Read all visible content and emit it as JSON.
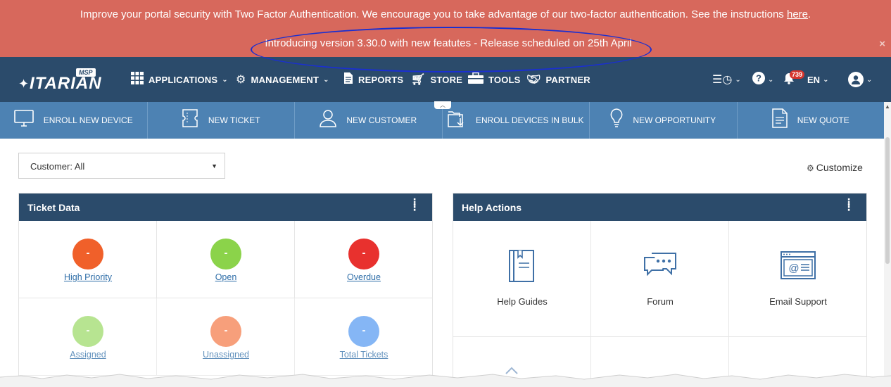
{
  "banner": {
    "line1_text": "Improve your portal security with Two Factor Authentication. We encourage you to take advantage of our two-factor authentication. See the instructions ",
    "line1_link": "here",
    "line1_end": ".",
    "line2_text": "Introducing version 3.30.0 with new featutes - Release scheduled on 25th April",
    "close_glyph": "×",
    "background": "#d7685c"
  },
  "logo": {
    "badge": "MSP",
    "word": "ITARIAN"
  },
  "nav": {
    "items": [
      {
        "label": "APPLICATIONS",
        "icon": "grid-icon"
      },
      {
        "label": "MANAGEMENT",
        "icon": "gears-icon"
      },
      {
        "label": "REPORTS",
        "icon": "document-icon"
      },
      {
        "label": "STORE",
        "icon": "cart-icon"
      },
      {
        "label": "TOOLS",
        "icon": "toolbox-icon"
      },
      {
        "label": "PARTNER",
        "icon": "handshake-icon"
      }
    ],
    "notification_count": "739",
    "language": "EN"
  },
  "quick_actions": [
    {
      "label": "ENROLL NEW DEVICE",
      "icon": "monitor-icon"
    },
    {
      "label": "NEW TICKET",
      "icon": "ticket-icon"
    },
    {
      "label": "NEW CUSTOMER",
      "icon": "user-icon"
    },
    {
      "label": "ENROLL DEVICES IN BULK",
      "icon": "devices-bulk-icon"
    },
    {
      "label": "NEW OPPORTUNITY",
      "icon": "lightbulb-icon"
    },
    {
      "label": "NEW QUOTE",
      "icon": "quote-document-icon"
    }
  ],
  "customer_select": {
    "value": "Customer: All"
  },
  "customize_label": "Customize",
  "ticket_widget": {
    "title": "Ticket Data",
    "cells": [
      {
        "label": "High Priority",
        "value": "-",
        "color": "#f0602a"
      },
      {
        "label": "Open",
        "value": "-",
        "color": "#8bd34a"
      },
      {
        "label": "Overdue",
        "value": "-",
        "color": "#e8312e"
      },
      {
        "label": "Assigned",
        "value": "-",
        "color": "#9fdc6d"
      },
      {
        "label": "Unassigned",
        "value": "-",
        "color": "#f5804f"
      },
      {
        "label": "Total Tickets",
        "value": "-",
        "color": "#5d9ef2"
      }
    ]
  },
  "help_widget": {
    "title": "Help Actions",
    "items": [
      {
        "label": "Help Guides",
        "icon": "book-icon"
      },
      {
        "label": "Forum",
        "icon": "chat-bubbles-icon"
      },
      {
        "label": "Email Support",
        "icon": "email-at-icon"
      }
    ]
  },
  "colors": {
    "nav_bg": "#2b4b6b",
    "quickbar_bg": "#4d82b3",
    "link_color": "#2f6ea8"
  }
}
